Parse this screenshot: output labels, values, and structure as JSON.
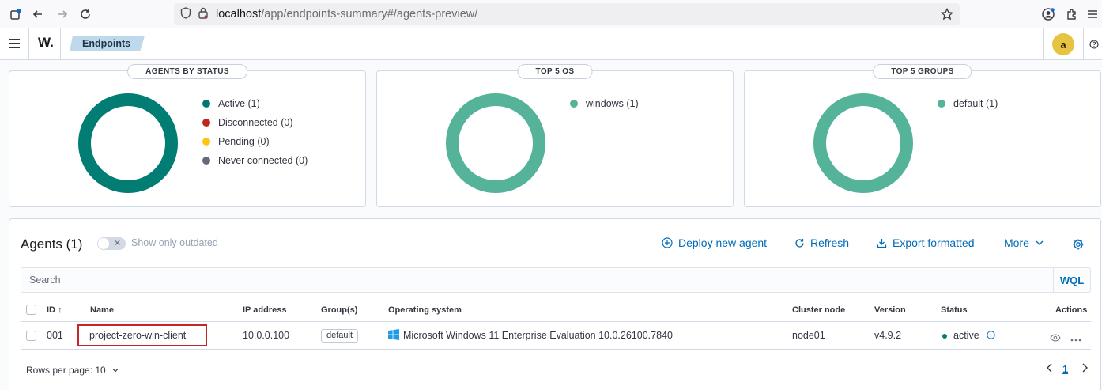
{
  "browser": {
    "url_host": "localhost",
    "url_path": "/app/endpoints-summary#/agents-preview/"
  },
  "header": {
    "logo": "W.",
    "breadcrumb": "Endpoints",
    "avatar": "a"
  },
  "panels": {
    "status": {
      "title": "AGENTS BY STATUS",
      "legend": [
        {
          "label": "Active (1)",
          "color": "#007871"
        },
        {
          "label": "Disconnected (0)",
          "color": "#bd271e"
        },
        {
          "label": "Pending (0)",
          "color": "#fec514"
        },
        {
          "label": "Never connected (0)",
          "color": "#646a77"
        }
      ],
      "ring_color": "#017d73"
    },
    "os": {
      "title": "TOP 5 OS",
      "legend": [
        {
          "label": "windows (1)",
          "color": "#54b399"
        }
      ],
      "ring_color": "#54b399"
    },
    "groups": {
      "title": "TOP 5 GROUPS",
      "legend": [
        {
          "label": "default (1)",
          "color": "#54b399"
        }
      ],
      "ring_color": "#54b399"
    }
  },
  "agents": {
    "title": "Agents (1)",
    "outdated_label": "Show only outdated",
    "deploy": "Deploy new agent",
    "refresh": "Refresh",
    "export": "Export formatted",
    "more": "More",
    "search_placeholder": "Search",
    "wql": "WQL",
    "columns": {
      "id": "ID",
      "name": "Name",
      "ip": "IP address",
      "groups": "Group(s)",
      "os": "Operating system",
      "node": "Cluster node",
      "version": "Version",
      "status": "Status",
      "actions": "Actions"
    },
    "rows": [
      {
        "id": "001",
        "name": "project-zero-win-client",
        "ip": "10.0.0.100",
        "group": "default",
        "os": "Microsoft Windows 11 Enterprise Evaluation 10.0.26100.7840",
        "node": "node01",
        "version": "v4.9.2",
        "status": "active"
      }
    ],
    "rows_per_page": "Rows per page: 10",
    "page": "1"
  }
}
